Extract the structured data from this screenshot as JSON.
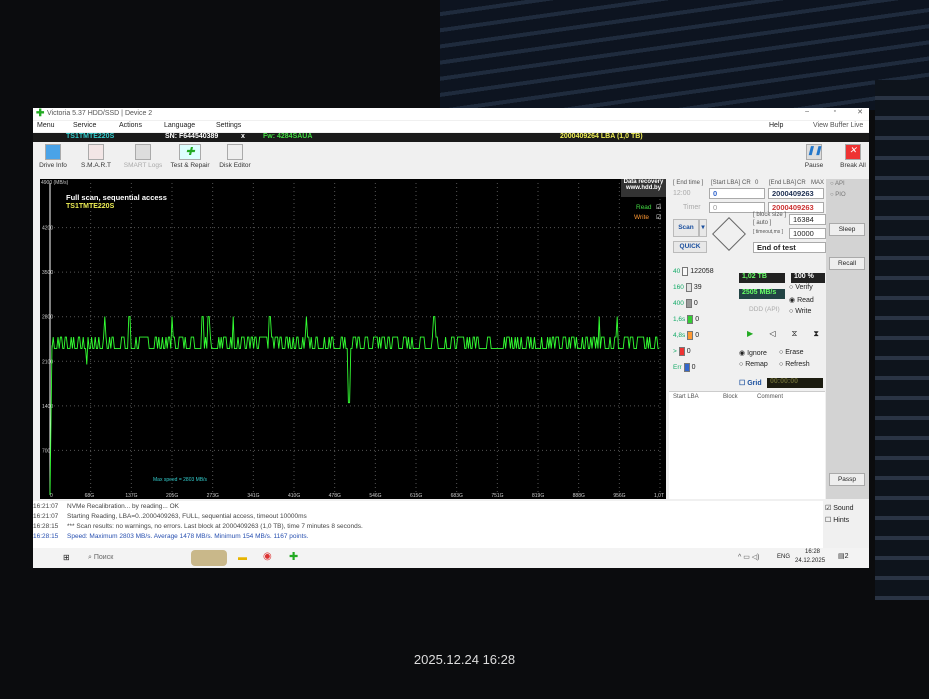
{
  "window": {
    "title": "Victoria 5.37 HDD/SSD | Device 2"
  },
  "menu": [
    "Menu",
    "Service",
    "Actions",
    "Language",
    "Settings"
  ],
  "menu_right": {
    "help": "Help",
    "view_buffer": "View Buffer Live"
  },
  "drive_info": {
    "model": "TS1TMTE220S",
    "serial": "SN: F644540389",
    "close": "x",
    "firmware": "Fw: 4284SAUA",
    "capacity": "2000409264 LBA (1,0 TB)"
  },
  "toolbar": [
    "Drive Info",
    "S.M.A.R.T",
    "SMART Logs",
    "Test & Repair",
    "Disk Editor"
  ],
  "top_right": {
    "pause": "Pause",
    "break_all": "Break All"
  },
  "chart_data": {
    "type": "line",
    "title": "Full scan, sequential access",
    "subtitle": "TS1TMTE220S",
    "ylabel": "4900 (MB/s)",
    "yticks": [
      "4200",
      "3500",
      "2800",
      "2100",
      "1400",
      "700"
    ],
    "ylim": [
      0,
      4900
    ],
    "xticks": [
      "0",
      "68G",
      "137G",
      "205G",
      "273G",
      "341G",
      "410G",
      "478G",
      "546G",
      "615G",
      "683G",
      "751G",
      "819G",
      "888G",
      "956G",
      "1,0T"
    ],
    "annotation": "Max speed = 2803 MB/s",
    "legend": [
      "Read",
      "Write"
    ],
    "watermark": [
      "Data recovery",
      "www.hdd.by"
    ],
    "grid": true,
    "series": [
      {
        "name": "Read",
        "x_unit": "fraction of disk",
        "spikes_at": [
          0.09,
          0.13,
          0.2,
          0.25,
          0.26,
          0.3,
          0.36,
          0.42,
          0.63,
          0.9,
          0.93
        ],
        "dips_at": [
          {
            "x": 0.06,
            "y": 2050
          },
          {
            "x": 0.49,
            "y": 1450
          }
        ],
        "baseline_min": 2300,
        "baseline_max": 2480,
        "spike_value": 2803
      }
    ]
  },
  "panel": {
    "end_time_lbl": "[ End time ]",
    "start_lba_lbl": "[Start LBA]",
    "cr": "CR",
    "zero": "0",
    "end_lba_lbl": "[End LBA]",
    "cr2": "CR",
    "max": "MAX",
    "end_time": "12:00",
    "start_lba": "0",
    "end_lba": "2000409263",
    "timer_lbl": "Timer",
    "timer_val": "0",
    "end_lba2": "2000409263",
    "scan": "Scan",
    "quick": "QUICK",
    "block_size_lbl": "[ block size ]",
    "auto_lbl": "[ auto ]",
    "timeout_lbl": "[ timeout,ms ]",
    "block_size": "16384",
    "timeout": "10000",
    "end_of_test": "End of test",
    "api": "API",
    "pio": "PIO",
    "sleep": "Sleep",
    "recall": "Recall",
    "passp": "Passp",
    "blocks": [
      {
        "label": "40",
        "count": "122058",
        "color": "#f8f8f8"
      },
      {
        "label": "160",
        "count": "39",
        "color": "#e0e0e0"
      },
      {
        "label": "400",
        "count": "0",
        "color": "#999"
      },
      {
        "label": "1,6s",
        "count": "0",
        "color": "#3c3"
      },
      {
        "label": "4,8s",
        "count": "0",
        "color": "#f93"
      },
      {
        "label": ">",
        "count": "0",
        "color": "#e33"
      },
      {
        "label": "Err",
        "count": "0",
        "color": "#36c"
      }
    ],
    "progress_tb": "1,02 TB",
    "percent": "100",
    "percent_sign": "%",
    "progress_fraction": 1.0,
    "speed": "2505 MB/s",
    "ddd": "DDD (API)",
    "modes": [
      "Verify",
      "Read",
      "Write"
    ],
    "selected_mode": "Read",
    "actions": [
      "Ignore",
      "Erase",
      "Remap",
      "Refresh"
    ],
    "selected_action": "Ignore",
    "grid_lbl": "Grid",
    "grid_time": "00:00:00",
    "table_headers": [
      "Start LBA",
      "Block",
      "Comment"
    ],
    "sound": "Sound",
    "hints": "Hints"
  },
  "log": [
    {
      "time": "16:21:07",
      "text": "NVMe Recalibration... by reading... OK",
      "color": "#444"
    },
    {
      "time": "16:21:07",
      "text": "Starting Reading, LBA=0..2000409263, FULL, sequential access, timeout 10000ms",
      "color": "#444"
    },
    {
      "time": "16:28:15",
      "text": "*** Scan results: no warnings, no errors. Last block at 2000409263 (1,0 TB), time 7 minutes 8 seconds.",
      "color": "#444"
    },
    {
      "time": "16:28:15",
      "text": "Speed: Maximum 2803 MB/s. Average 1478 MB/s. Minimum 154 MB/s. 1167 points.",
      "color": "#2850b0"
    }
  ],
  "taskbar": {
    "search": "Поиск",
    "lang": "ENG",
    "time": "16:28",
    "date": "24.12.2025",
    "notif": "2"
  },
  "photo_stamp": "2025.12.24 16:28"
}
